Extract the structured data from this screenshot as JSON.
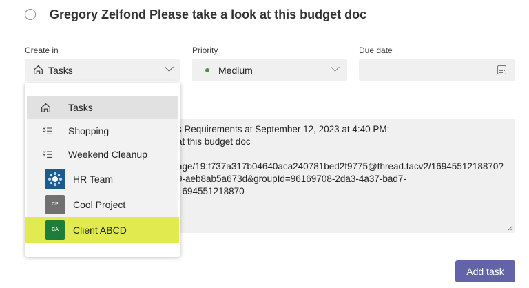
{
  "task": {
    "title": "Gregory Zelfond Please take a look at this budget doc"
  },
  "fields": {
    "create_in": {
      "label": "Create in",
      "value": "Tasks"
    },
    "priority": {
      "label": "Priority",
      "value": "Medium",
      "dot_color": "#3a9b3a"
    },
    "due_date": {
      "label": "Due date",
      "value": ""
    }
  },
  "notes": {
    "lines": [
      "s Requirements at September 12, 2023 at 4:40 PM:",
      "at this budget doc",
      "",
      "age/19:f737a317b04640aca240781bed2f9775@thread.tacv2/1694551218870?",
      "9-aeb8ab5a673d&groupId=96169708-2da3-4a37-bad7-",
      "1694551218870"
    ]
  },
  "dropdown": {
    "items": [
      {
        "label": "Tasks",
        "icon": "home-icon"
      },
      {
        "label": "Shopping",
        "icon": "checklist-icon"
      },
      {
        "label": "Weekend Cleanup",
        "icon": "checklist-icon"
      },
      {
        "label": "HR Team",
        "icon": "hr-team-logo"
      },
      {
        "label": "Cool Project",
        "icon": "cool-project-tile",
        "initials": "CP"
      },
      {
        "label": "Client ABCD",
        "icon": "client-abcd-tile",
        "initials": "CA"
      }
    ]
  },
  "actions": {
    "add_task": "Add task"
  },
  "colors": {
    "accent": "#6264a7",
    "highlight": "#e1eb50"
  }
}
